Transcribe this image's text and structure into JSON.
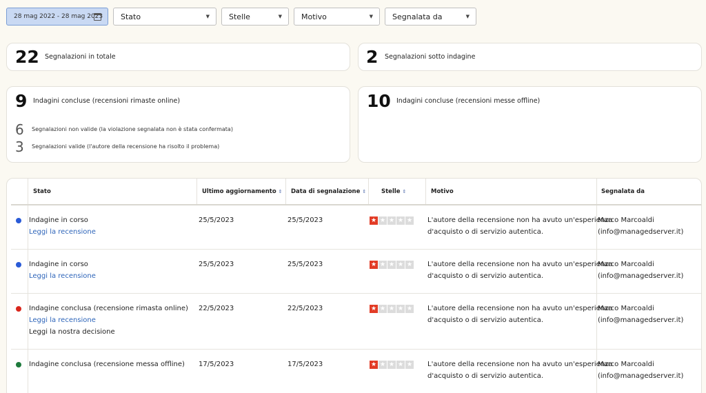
{
  "filters": {
    "date_range": "28 mag 2022 - 28 mag 2023",
    "stato": "Stato",
    "stelle": "Stelle",
    "motivo": "Motivo",
    "segnalata_da": "Segnalata da"
  },
  "stats": {
    "total_value": "22",
    "total_label": "Segnalazioni in totale",
    "under_value": "2",
    "under_label": "Segnalazioni sotto indagine",
    "online_value": "9",
    "online_label": "Indagini concluse (recensioni rimaste online)",
    "invalid_value": "6",
    "invalid_label": "Segnalazioni non valide (la violazione segnalata non è stata confermata)",
    "valid_value": "3",
    "valid_label": "Segnalazioni valide (l'autore della recensione ha risolto il problema)",
    "offline_value": "10",
    "offline_label": "Indagini concluse (recensioni messe offline)"
  },
  "table": {
    "headers": {
      "stato": "Stato",
      "ultimo": "Ultimo aggiornamento",
      "data": "Data di segnalazione",
      "stelle": "Stelle",
      "motivo": "Motivo",
      "segnalata": "Segnalata da"
    },
    "rows": [
      {
        "status_color": "#2a5bd7",
        "status": "Indagine in corso",
        "link1": "Leggi la recensione",
        "link2": "",
        "updated": "25/5/2023",
        "reported": "25/5/2023",
        "stars": 1,
        "reason_line1": "L'autore della recensione non ha avuto un'esperienza",
        "reason_line2": "d'acquisto o di servizio autentica.",
        "by_name": "Marco Marcoaldi",
        "by_email": "(info@managedserver.it)"
      },
      {
        "status_color": "#2a5bd7",
        "status": "Indagine in corso",
        "link1": "Leggi la recensione",
        "link2": "",
        "updated": "25/5/2023",
        "reported": "25/5/2023",
        "stars": 1,
        "reason_line1": "L'autore della recensione non ha avuto un'esperienza",
        "reason_line2": "d'acquisto o di servizio autentica.",
        "by_name": "Marco Marcoaldi",
        "by_email": "(info@managedserver.it)"
      },
      {
        "status_color": "#d9261c",
        "status": "Indagine conclusa (recensione rimasta online)",
        "link1": "Leggi la recensione",
        "link2": "Leggi la nostra decisione",
        "updated": "22/5/2023",
        "reported": "22/5/2023",
        "stars": 1,
        "reason_line1": "L'autore della recensione non ha avuto un'esperienza",
        "reason_line2": "d'acquisto o di servizio autentica.",
        "by_name": "Marco Marcoaldi",
        "by_email": "(info@managedserver.it)"
      },
      {
        "status_color": "#1e7a3c",
        "status": "Indagine conclusa (recensione messa offline)",
        "link1": "",
        "link2": "",
        "updated": "17/5/2023",
        "reported": "17/5/2023",
        "stars": 1,
        "reason_line1": "L'autore della recensione non ha avuto un'esperienza",
        "reason_line2": "d'acquisto o di servizio autentica.",
        "by_name": "Marco Marcoaldi",
        "by_email": "(info@managedserver.it)"
      }
    ]
  }
}
